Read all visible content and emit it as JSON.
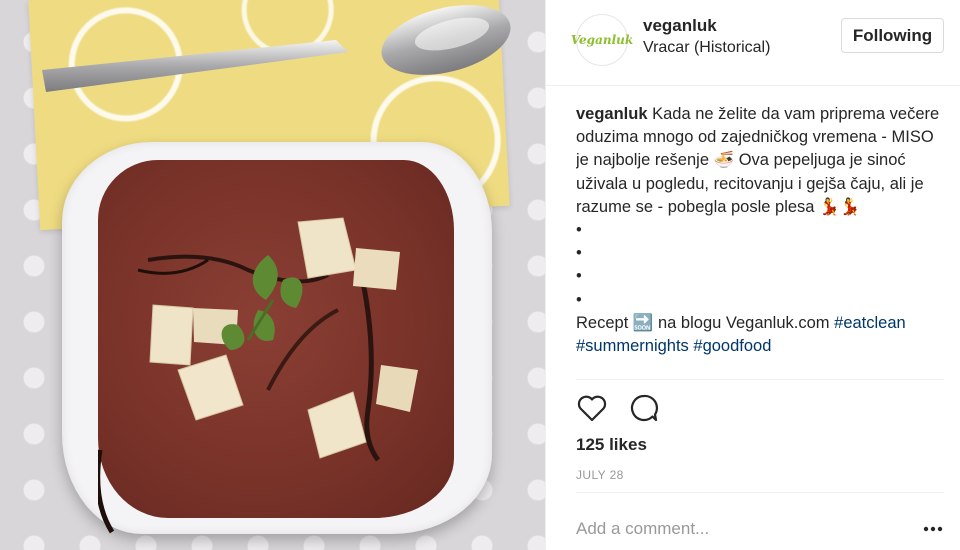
{
  "post": {
    "image_alt": "Miso soup with tofu and parsley in a white square bowl"
  },
  "header": {
    "avatar_text": "Veganluk",
    "username": "veganluk",
    "location": "Vracar (Historical)",
    "follow_label": "Following"
  },
  "caption": {
    "username": "veganluk",
    "text": "Kada ne želite da vam priprema večere oduzima mnogo od zajedničkog vremena - MISO je najbolje rešenje 🍜 Ova pepeljuga je sinoć uživala u pogledu, recitovanju i gejša čaju, ali je razume se - pobegla posle plesa 💃💃",
    "bullets": [
      "•",
      "•",
      "•",
      "•"
    ],
    "recipe_prefix": "Recept 🔜 na blogu Veganluk.com",
    "hashtags": [
      "#eatclean",
      "#summernights",
      "#goodfood"
    ]
  },
  "actions": {
    "like_icon": "heart-outline-icon",
    "comment_icon": "comment-bubble-icon"
  },
  "likes": "125 likes",
  "date": "JULY 28",
  "comment_box": {
    "placeholder": "Add a comment...",
    "more_icon": "ellipsis-icon"
  },
  "colors": {
    "hashtag": "#003569",
    "text": "#262626",
    "muted": "#999999",
    "border": "#efefef"
  }
}
